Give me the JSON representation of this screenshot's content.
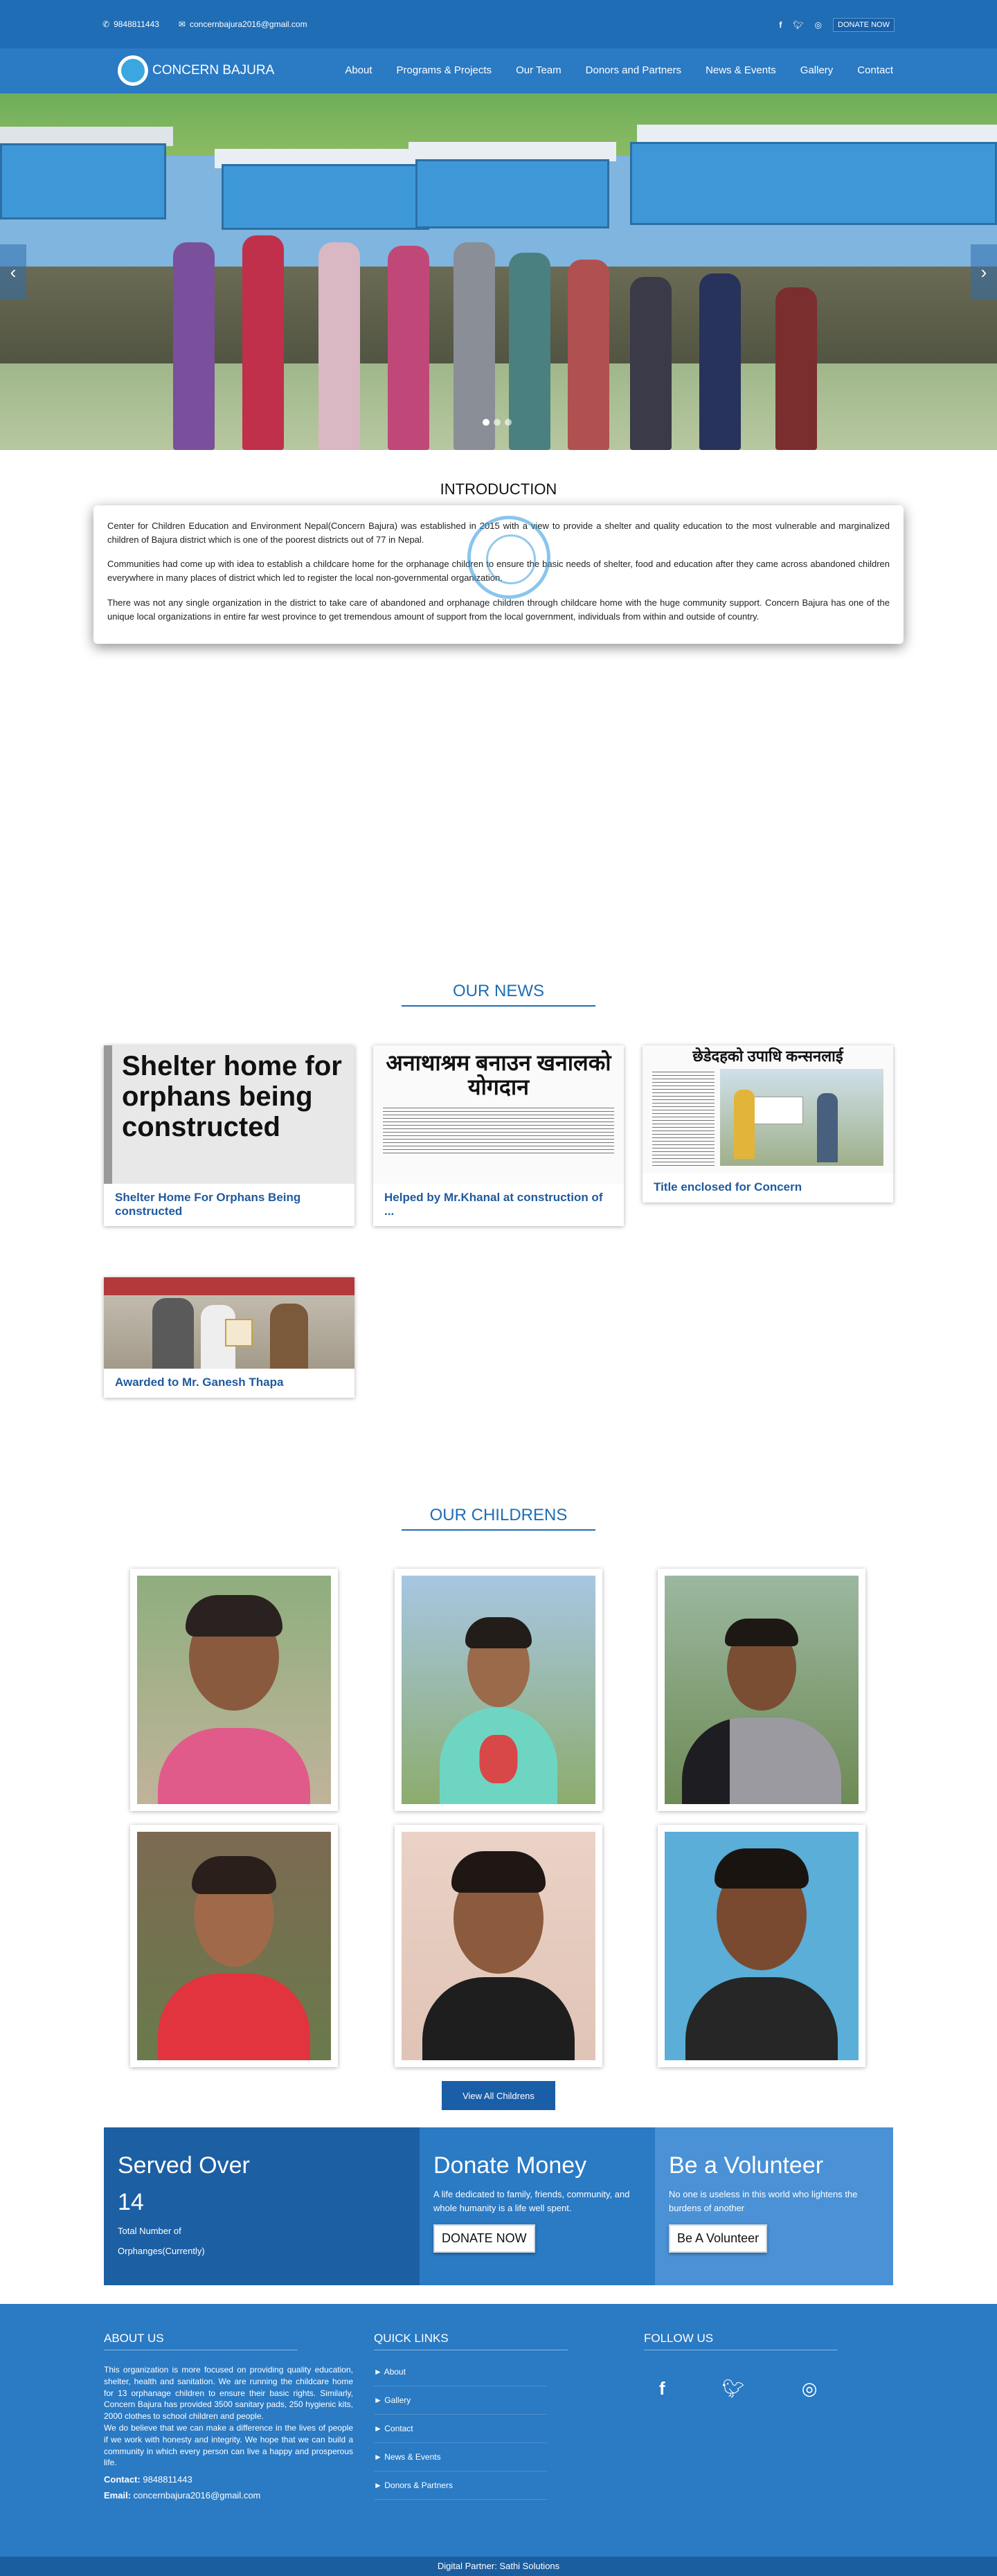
{
  "topbar": {
    "phone": "9848811443",
    "email": "concernbajura2016@gmail.com",
    "social": [
      "facebook-icon",
      "twitter-icon",
      "instagram-icon"
    ],
    "donate": "DONATE NOW"
  },
  "nav": {
    "brand": "CONCERN BAJURA",
    "items": [
      "About",
      "Programs & Projects",
      "Our Team",
      "Donors and Partners",
      "News & Events",
      "Gallery",
      "Contact"
    ]
  },
  "hero": {
    "prev": "‹",
    "next": "›",
    "slides": 3,
    "active": 0
  },
  "intro": {
    "title": "INTRODUCTION",
    "paragraphs": [
      "Center for Children Education and Environment Nepal(Concern Bajura) was established in 2015 with a view to provide a shelter and quality education to the most vulnerable and marginalized children of Bajura district which is one of the poorest districts out of 77 in Nepal.",
      "Communities had come up with idea to establish a childcare home for the orphanage children to ensure the basic needs of shelter, food and education after they came across abandoned children everywhere in many places of district which led to register the local non-governmental organization.",
      "There was not any single organization in the district to take care of abandoned and orphanage children through childcare home with the huge community support. Concern Bajura has one of the unique local organizations in entire far west province to get tremendous amount of support from the local government, individuals from within and outside of country."
    ]
  },
  "news": {
    "title": "OUR NEWS",
    "items": [
      {
        "caption": "Shelter Home For Orphans Being constructed",
        "headline": "Shelter home for orphans being constructed"
      },
      {
        "caption": "Helped by Mr.Khanal at construction of ...",
        "headline": "अनाथाश्रम बनाउन खनालको योगदान"
      },
      {
        "caption": "Title enclosed for Concern",
        "headline": "छेडेदहको उपाधि कन्सनलाई"
      },
      {
        "caption": "Awarded to Mr. Ganesh Thapa",
        "headline": ""
      }
    ]
  },
  "children": {
    "title": "OUR CHILDRENS",
    "view_all": "View All Childrens"
  },
  "bands": {
    "served": {
      "title": "Served Over",
      "count": "14",
      "label": "Total Number of Orphanges(Currently)"
    },
    "donate": {
      "title": "Donate Money",
      "text": "A life dedicated to family, friends, community, and whole humanity is a life well spent.",
      "button": "DONATE NOW"
    },
    "volunteer": {
      "title": "Be a Volunteer",
      "text": "No one is useless in this world who lightens the burdens of another",
      "button": "Be A Volunteer"
    }
  },
  "footer": {
    "about_title": "ABOUT US",
    "about_text": "This organization is more focused on providing quality education, shelter, health and sanitation. We are running the childcare home for 13 orphanage children to ensure their basic rights. Similarly, Concern Bajura has provided 3500 sanitary pads, 250 hygienic kits, 2000 clothes to school children and people.",
    "about_text2": "We do believe that we can make a difference in the lives of people if we work with honesty and integrity. We hope that we can build a community in which every person can live a happy and prosperous life.",
    "contact_label": "Contact:",
    "contact": "9848811443",
    "email_label": "Email:",
    "email": "concernbajura2016@gmail.com",
    "links_title": "QUICK LINKS",
    "links": [
      "About",
      "Gallery",
      "Contact",
      "News & Events",
      "Donors & Partners"
    ],
    "follow_title": "FOLLOW US",
    "credit": "Digital Partner: Sathi Solutions"
  },
  "colors": {
    "primary": "#2a7ac4",
    "dark": "#1a5ea8",
    "served_bg": "#1c5fa3",
    "donate_bg": "#2a7ac4",
    "volunteer_bg": "#4a91d6"
  }
}
